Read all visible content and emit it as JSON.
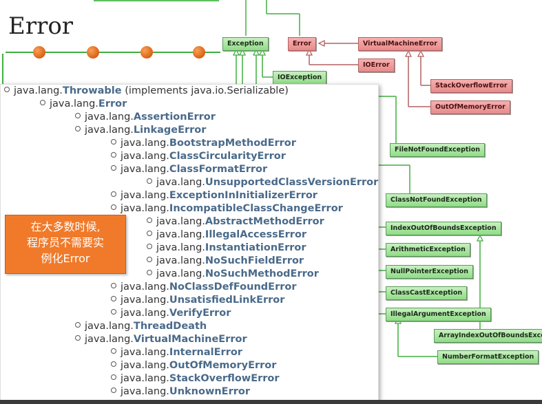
{
  "slide": {
    "title": "Error",
    "note_lines": [
      "在大多数时候,",
      "程序员不需要实",
      "例化Error"
    ]
  },
  "diagram": {
    "classes": {
      "exception": "Exception",
      "error": "Error",
      "vm_error": "VirtualMachineError",
      "io_error": "IOError",
      "io_exception": "IOException",
      "stack_overflow": "StackOverflowError",
      "out_of_memory": "OutOfMemoryError",
      "file_not_found": "FileNotFoundException",
      "class_not_found": "ClassNotFoundException",
      "index_oob": "IndexOutOfBoundsException",
      "arithmetic": "ArithmeticException",
      "null_pointer": "NullPointerException",
      "class_cast": "ClassCastException",
      "illegal_argument": "IllegalArgumentException",
      "array_index_oob": "ArrayIndexOutOfBoundsExcepti",
      "number_format": "NumberFormatException"
    }
  },
  "hierarchy": [
    {
      "pkg": "java.lang.",
      "name": "Throwable",
      "suffix": " (implements java.io.Serializable)"
    },
    {
      "pkg": "java.lang.",
      "name": "Error",
      "suffix": ""
    },
    {
      "pkg": "java.lang.",
      "name": "AssertionError",
      "suffix": ""
    },
    {
      "pkg": "java.lang.",
      "name": "LinkageError",
      "suffix": ""
    },
    {
      "pkg": "java.lang.",
      "name": "BootstrapMethodError",
      "suffix": ""
    },
    {
      "pkg": "java.lang.",
      "name": "ClassCircularityError",
      "suffix": ""
    },
    {
      "pkg": "java.lang.",
      "name": "ClassFormatError",
      "suffix": ""
    },
    {
      "pkg": "java.lang.",
      "name": "UnsupportedClassVersionError",
      "suffix": ""
    },
    {
      "pkg": "java.lang.",
      "name": "ExceptionInInitializerError",
      "suffix": ""
    },
    {
      "pkg": "java.lang.",
      "name": "IncompatibleClassChangeError",
      "suffix": ""
    },
    {
      "pkg": "java.lang.",
      "name": "AbstractMethodError",
      "suffix": ""
    },
    {
      "pkg": "java.lang.",
      "name": "IllegalAccessError",
      "suffix": ""
    },
    {
      "pkg": "java.lang.",
      "name": "InstantiationError",
      "suffix": ""
    },
    {
      "pkg": "java.lang.",
      "name": "NoSuchFieldError",
      "suffix": ""
    },
    {
      "pkg": "java.lang.",
      "name": "NoSuchMethodError",
      "suffix": ""
    },
    {
      "pkg": "java.lang.",
      "name": "NoClassDefFoundError",
      "suffix": ""
    },
    {
      "pkg": "java.lang.",
      "name": "UnsatisfiedLinkError",
      "suffix": ""
    },
    {
      "pkg": "java.lang.",
      "name": "VerifyError",
      "suffix": ""
    },
    {
      "pkg": "java.lang.",
      "name": "ThreadDeath",
      "suffix": ""
    },
    {
      "pkg": "java.lang.",
      "name": "VirtualMachineError",
      "suffix": ""
    },
    {
      "pkg": "java.lang.",
      "name": "InternalError",
      "suffix": ""
    },
    {
      "pkg": "java.lang.",
      "name": "OutOfMemoryError",
      "suffix": ""
    },
    {
      "pkg": "java.lang.",
      "name": "StackOverflowError",
      "suffix": ""
    },
    {
      "pkg": "java.lang.",
      "name": "UnknownError",
      "suffix": ""
    }
  ],
  "colors": {
    "accent_orange": "#f07a2a",
    "class_green": "#8fdc86",
    "class_red": "#e88a8a",
    "link_name": "#4a6a8a"
  }
}
